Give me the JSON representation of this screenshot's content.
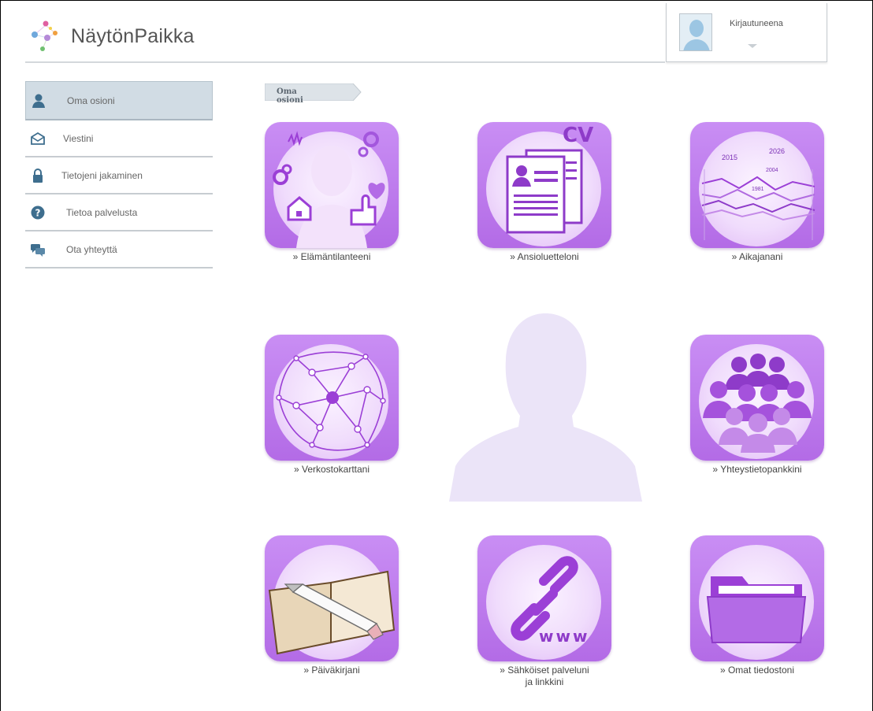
{
  "app": {
    "name": "NäytönPaikka"
  },
  "user": {
    "status_label": "Kirjautuneena"
  },
  "sidebar": {
    "items": [
      {
        "label": "Oma osioni",
        "icon": "person-icon",
        "active": true
      },
      {
        "label": "Viestini",
        "icon": "envelope-icon",
        "active": false
      },
      {
        "label": "Tietojeni jakaminen",
        "icon": "lock-icon",
        "active": false
      },
      {
        "label": "Tietoa palvelusta",
        "icon": "question-icon",
        "active": false
      },
      {
        "label": "Ota yhteyttä",
        "icon": "chat-icon",
        "active": false
      }
    ]
  },
  "breadcrumb": {
    "label": "Oma osioni"
  },
  "tiles": [
    {
      "label": "» Elämäntilanteeni",
      "icon": "life-situation-icon"
    },
    {
      "label": "» Ansioluetteloni",
      "icon": "cv-document-icon",
      "badge": "CV"
    },
    {
      "label": "» Aikajanani",
      "icon": "timeline-icon",
      "years": [
        "2015",
        "2026",
        "2004",
        "1981"
      ]
    },
    {
      "label": "» Verkostokarttani",
      "icon": "network-map-icon"
    },
    {
      "label": "» Yhteystietopankkini",
      "icon": "contacts-group-icon"
    },
    {
      "label": "» Päiväkirjani",
      "icon": "diary-icon"
    },
    {
      "label": "» Sähköiset palveluni",
      "label2": "ja linkkini",
      "icon": "link-chain-icon",
      "badge": "www"
    },
    {
      "label": "» Omat tiedostoni",
      "icon": "folder-icon"
    }
  ],
  "colors": {
    "tile_purple": "#b36be6",
    "sidebar_active": "#d1dce4",
    "divider": "#c7ccd1"
  }
}
